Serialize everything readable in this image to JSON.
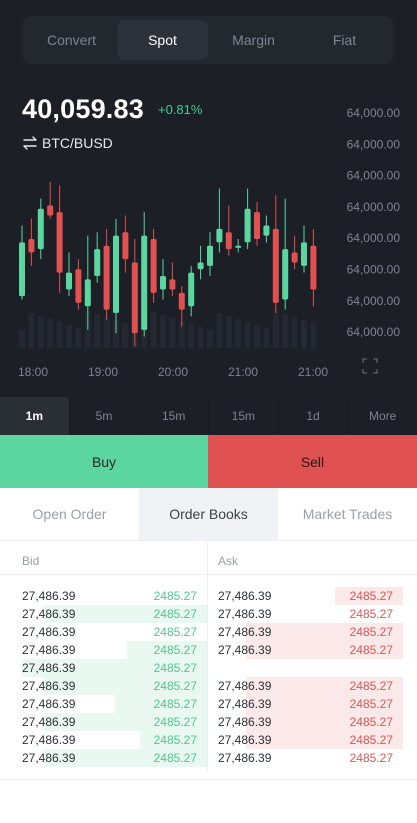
{
  "market_tabs": [
    "Convert",
    "Spot",
    "Margin",
    "Fiat"
  ],
  "active_market_tab": 1,
  "ticker": {
    "price": "40,059.83",
    "change": "+0.81%",
    "pair": "BTC/BUSD"
  },
  "chart_data": {
    "type": "candlestick",
    "y_tick_labels": [
      "64,000.00",
      "64,000.00",
      "64,000.00",
      "64,000.00",
      "64,000.00",
      "64,000.00",
      "64,000.00",
      "64,000.00"
    ],
    "x_tick_labels": [
      "18:00",
      "19:00",
      "20:00",
      "21:00",
      "21:00"
    ],
    "up_color": "#5cd6a0",
    "down_color": "#e05151",
    "candles": [
      {
        "open": 31,
        "close": 47,
        "high": 52,
        "low": 30
      },
      {
        "open": 48,
        "close": 44,
        "high": 54,
        "low": 40
      },
      {
        "open": 45,
        "close": 57,
        "high": 60,
        "low": 42
      },
      {
        "open": 58,
        "close": 55,
        "high": 65,
        "low": 54
      },
      {
        "open": 56,
        "close": 38,
        "high": 64,
        "low": 32
      },
      {
        "open": 33,
        "close": 38,
        "high": 44,
        "low": 31
      },
      {
        "open": 39,
        "close": 29,
        "high": 42,
        "low": 27
      },
      {
        "open": 28,
        "close": 36,
        "high": 49,
        "low": 21
      },
      {
        "open": 37,
        "close": 45,
        "high": 50,
        "low": 35
      },
      {
        "open": 46,
        "close": 27,
        "high": 51,
        "low": 24
      },
      {
        "open": 26,
        "close": 49,
        "high": 54,
        "low": 20
      },
      {
        "open": 50,
        "close": 42,
        "high": 55,
        "low": 38
      },
      {
        "open": 41,
        "close": 20,
        "high": 48,
        "low": 16
      },
      {
        "open": 21,
        "close": 49,
        "high": 56,
        "low": 19
      },
      {
        "open": 48,
        "close": 32,
        "high": 51,
        "low": 29
      },
      {
        "open": 33,
        "close": 37,
        "high": 42,
        "low": 30
      },
      {
        "open": 36,
        "close": 33,
        "high": 41,
        "low": 31
      },
      {
        "open": 32,
        "close": 27,
        "high": 34,
        "low": 22
      },
      {
        "open": 28,
        "close": 38,
        "high": 40,
        "low": 25
      },
      {
        "open": 39,
        "close": 41,
        "high": 46,
        "low": 36
      },
      {
        "open": 40,
        "close": 46,
        "high": 50,
        "low": 37
      },
      {
        "open": 47,
        "close": 51,
        "high": 63,
        "low": 44
      },
      {
        "open": 50,
        "close": 45,
        "high": 58,
        "low": 43
      },
      {
        "open": 46,
        "close": 46,
        "high": 48,
        "low": 44
      },
      {
        "open": 47,
        "close": 57,
        "high": 63,
        "low": 45
      },
      {
        "open": 56,
        "close": 48,
        "high": 59,
        "low": 46
      },
      {
        "open": 49,
        "close": 52,
        "high": 55,
        "low": 47
      },
      {
        "open": 51,
        "close": 29,
        "high": 61,
        "low": 26
      },
      {
        "open": 30,
        "close": 45,
        "high": 60,
        "low": 27
      },
      {
        "open": 44,
        "close": 41,
        "high": 49,
        "low": 39
      },
      {
        "open": 40,
        "close": 47,
        "high": 52,
        "low": 38
      },
      {
        "open": 46,
        "close": 33,
        "high": 51,
        "low": 28
      }
    ]
  },
  "timeframes": [
    "1m",
    "5m",
    "15m",
    "15m",
    "1d",
    "More"
  ],
  "active_timeframe": 0,
  "actions": {
    "buy": "Buy",
    "sell": "Sell"
  },
  "order_tabs": [
    "Open Order",
    "Order Books",
    "Market Trades"
  ],
  "active_order_tab": 1,
  "order_book": {
    "bid_header": "Bid",
    "ask_header": "Ask",
    "bids": [
      {
        "price": "27,486.39",
        "qty": "2485.27",
        "depth": 0.0
      },
      {
        "price": "27,486.39",
        "qty": "2485.27",
        "depth": 0.88
      },
      {
        "price": "27,486.39",
        "qty": "2485.27",
        "depth": 0.0
      },
      {
        "price": "27,486.39",
        "qty": "2485.27",
        "depth": 0.43
      },
      {
        "price": "27,486.39",
        "qty": "2485.27",
        "depth": 1.0
      },
      {
        "price": "27,486.39",
        "qty": "2485.27",
        "depth": 0.88
      },
      {
        "price": "27,486.39",
        "qty": "2485.27",
        "depth": 0.5
      },
      {
        "price": "27,486.39",
        "qty": "2485.27",
        "depth": 0.88
      },
      {
        "price": "27,486.39",
        "qty": "2485.27",
        "depth": 0.36
      },
      {
        "price": "27,486.39",
        "qty": "2485.27",
        "depth": 0.88
      }
    ],
    "asks": [
      {
        "price": "27,486.39",
        "qty": "2485.27",
        "depth": 0.37
      },
      {
        "price": "27,486.39",
        "qty": "2485.27",
        "depth": 0.0
      },
      {
        "price": "27,486.39",
        "qty": "2485.27",
        "depth": 0.85
      },
      {
        "price": "27,486.39",
        "qty": "2485.27",
        "depth": 0.85
      },
      null,
      {
        "price": "27,486.39",
        "qty": "2485.27",
        "depth": 0.85
      },
      {
        "price": "27,486.39",
        "qty": "2485.27",
        "depth": 0.85
      },
      {
        "price": "27,486.39",
        "qty": "2485.27",
        "depth": 0.85
      },
      {
        "price": "27,486.39",
        "qty": "2485.27",
        "depth": 0.85
      },
      {
        "price": "27,486.39",
        "qty": "2485.27",
        "depth": 0.0
      }
    ]
  }
}
